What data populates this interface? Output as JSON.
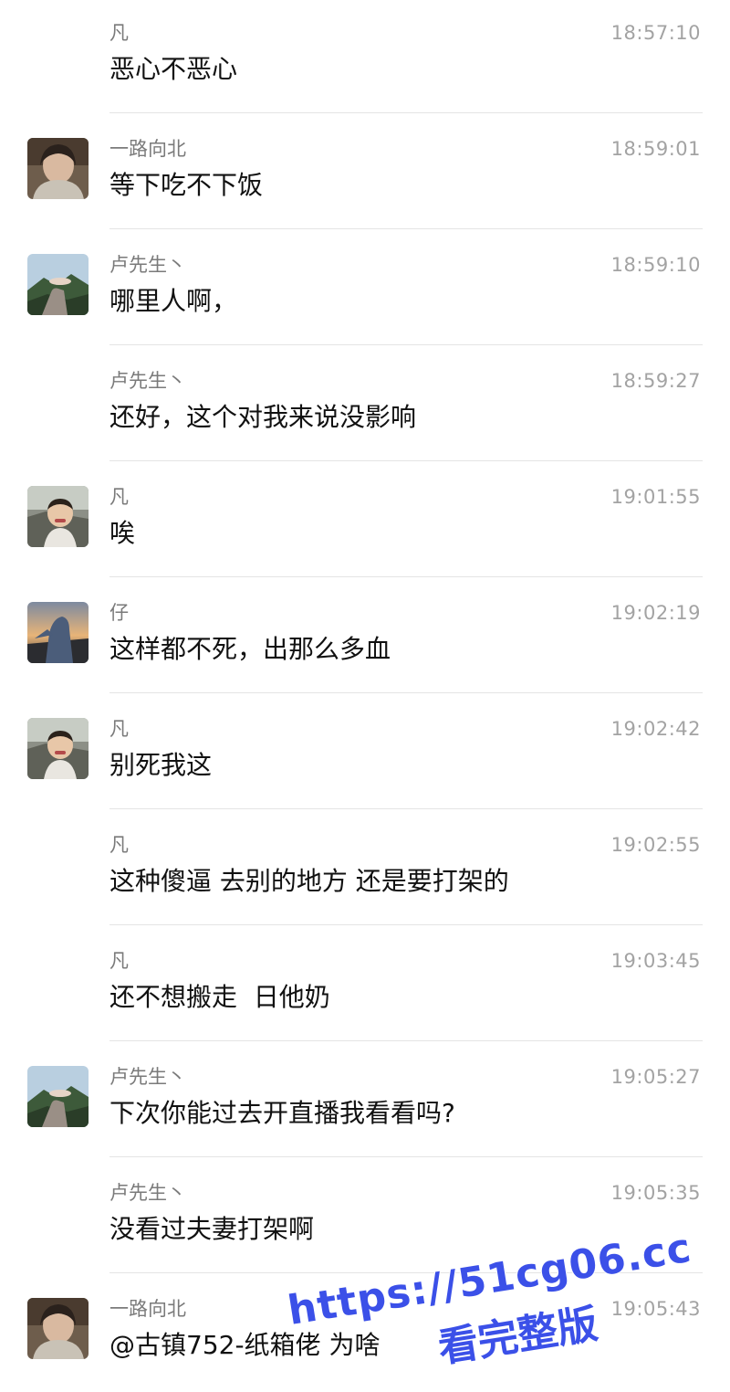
{
  "messages": [
    {
      "sender": "凡",
      "time": "18:57:10",
      "text": "恶心不恶心",
      "avatar": "none"
    },
    {
      "sender": "一路向北",
      "time": "18:59:01",
      "text": "等下吃不下饭",
      "avatar": "avatar-girl-photo"
    },
    {
      "sender": "卢先生丶",
      "time": "18:59:10",
      "text": "哪里人啊，",
      "avatar": "avatar-hand-mountain-photo"
    },
    {
      "sender": "卢先生丶",
      "time": "18:59:27",
      "text": "还好，这个对我来说没影响",
      "avatar": "none"
    },
    {
      "sender": "凡",
      "time": "19:01:55",
      "text": "唉",
      "avatar": "avatar-child-photo"
    },
    {
      "sender": "仔",
      "time": "19:02:19",
      "text": "这样都不死，出那么多血",
      "avatar": "avatar-sunset-figure-photo"
    },
    {
      "sender": "凡",
      "time": "19:02:42",
      "text": "别死我这",
      "avatar": "avatar-child-photo"
    },
    {
      "sender": "凡",
      "time": "19:02:55",
      "text": "这种傻逼 去别的地方 还是要打架的",
      "avatar": "none"
    },
    {
      "sender": "凡",
      "time": "19:03:45",
      "text": "还不想搬走  日他奶",
      "avatar": "none"
    },
    {
      "sender": "卢先生丶",
      "time": "19:05:27",
      "text": "下次你能过去开直播我看看吗?",
      "avatar": "avatar-hand-mountain-photo"
    },
    {
      "sender": "卢先生丶",
      "time": "19:05:35",
      "text": "没看过夫妻打架啊",
      "avatar": "none"
    },
    {
      "sender": "一路向北",
      "time": "19:05:43",
      "text": "@古镇752-纸箱佬 为啥",
      "avatar": "avatar-girl-photo"
    }
  ],
  "watermark": {
    "url": "https://51cg06.cc",
    "subtitle": "看完整版"
  },
  "colors": {
    "sender": "#7a7a7a",
    "time": "#a3a3a3",
    "text": "#111111",
    "divider": "#e4e4e4",
    "watermark": "#3b50e8"
  }
}
